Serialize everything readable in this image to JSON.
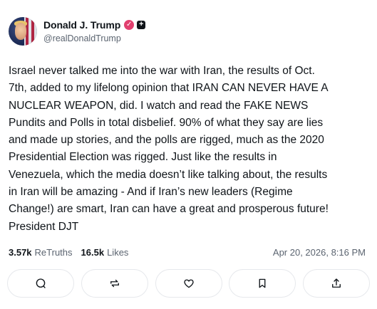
{
  "author": {
    "display_name": "Donald J. Trump",
    "handle": "@realDonaldTrump"
  },
  "post": {
    "text": "Israel never talked me into the war with Iran, the results of Oct.\n7th, added to my lifelong opinion that IRAN CAN NEVER HAVE A\nNUCLEAR WEAPON, did. I watch and read the FAKE NEWS\nPundits and Polls in total disbelief. 90% of what they say are lies\nand made up stories, and the polls are rigged, much as the 2020\nPresidential Election was rigged. Just like the results in\nVenezuela, which the media doesn’t like talking about, the results\nin Iran will be amazing - And if Iran’s new leaders (Regime\nChange!) are smart, Iran can have a great and prosperous future!\nPresident DJT"
  },
  "stats": {
    "retruths_count": "3.57k",
    "retruths_label": "ReTruths",
    "likes_count": "16.5k",
    "likes_label": "Likes",
    "timestamp": "Apr 20, 2026, 8:16 PM"
  },
  "colors": {
    "verified_badge": "#e13f6e",
    "muted_text": "#5b6470",
    "border": "#e6e8ec"
  },
  "icons": {
    "verified": "check-badge-icon",
    "plus": "plus-badge-icon",
    "reply": "reply-icon",
    "retruth": "retruth-icon",
    "like": "heart-icon",
    "bookmark": "bookmark-icon",
    "share": "share-icon"
  }
}
